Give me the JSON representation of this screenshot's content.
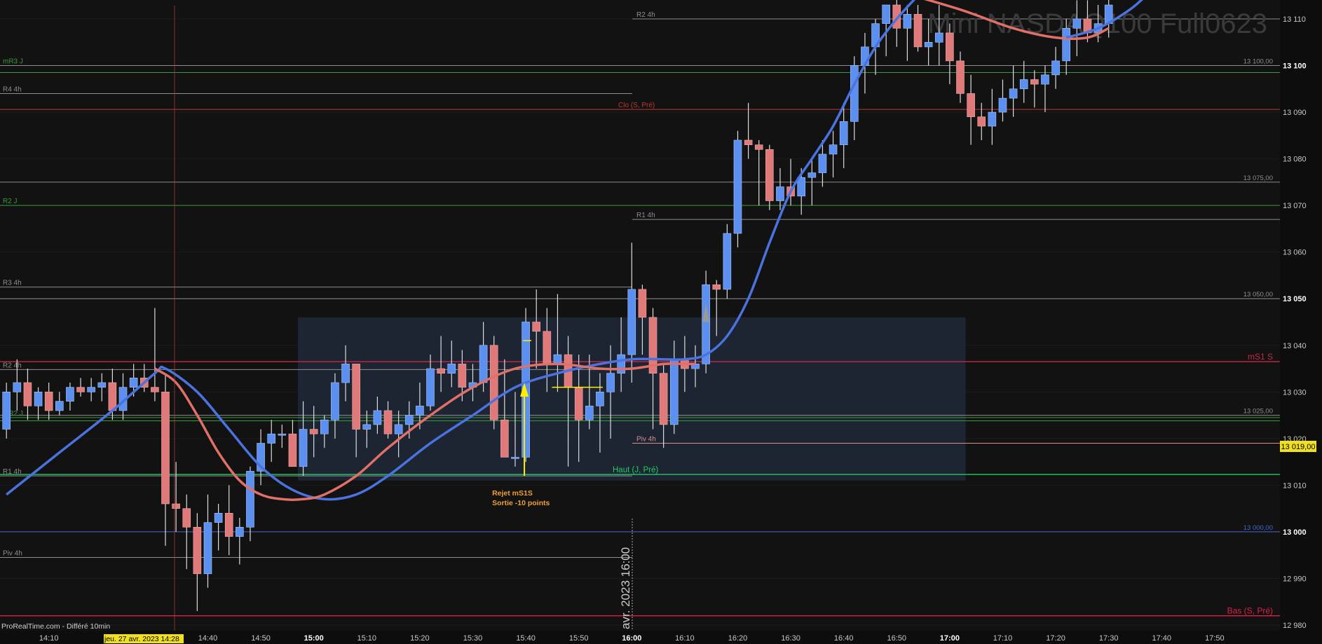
{
  "chart_data": {
    "type": "candlestick",
    "watermark": "Mini NASDAQ100 Full0623",
    "footer_note": "ProRealTime.com - Différé 10min",
    "cursor_label": "jeu. 27 avr. 2023 14:28",
    "vertical_date_label": "avr. 2023 16:00",
    "price_label": "13 019,00",
    "ylim": [
      12978,
      13113
    ],
    "y_ticks": [
      {
        "v": 13110,
        "t": "13 110",
        "b": false
      },
      {
        "v": 13100,
        "t": "13 100",
        "b": true
      },
      {
        "v": 13090,
        "t": "13 090",
        "b": false
      },
      {
        "v": 13080,
        "t": "13 080",
        "b": false
      },
      {
        "v": 13070,
        "t": "13 070",
        "b": false
      },
      {
        "v": 13060,
        "t": "13 060",
        "b": false
      },
      {
        "v": 13050,
        "t": "13 050",
        "b": true
      },
      {
        "v": 13040,
        "t": "13 040",
        "b": false
      },
      {
        "v": 13030,
        "t": "13 030",
        "b": false
      },
      {
        "v": 13020,
        "t": "13 020",
        "b": false
      },
      {
        "v": 13010,
        "t": "13 010",
        "b": false
      },
      {
        "v": 13000,
        "t": "13 000",
        "b": true
      },
      {
        "v": 12990,
        "t": "12 990",
        "b": false
      },
      {
        "v": 12980,
        "t": "12 980",
        "b": false
      }
    ],
    "x_ticks": [
      {
        "t": "14:10",
        "i": 4,
        "b": false
      },
      {
        "t": "14:40",
        "i": 19,
        "b": false
      },
      {
        "t": "14:50",
        "i": 24,
        "b": false
      },
      {
        "t": "15:00",
        "i": 29,
        "b": true
      },
      {
        "t": "15:10",
        "i": 34,
        "b": false
      },
      {
        "t": "15:20",
        "i": 39,
        "b": false
      },
      {
        "t": "15:30",
        "i": 44,
        "b": false
      },
      {
        "t": "15:40",
        "i": 49,
        "b": false
      },
      {
        "t": "15:50",
        "i": 54,
        "b": false
      },
      {
        "t": "16:00",
        "i": 59,
        "b": true
      },
      {
        "t": "16:10",
        "i": 64,
        "b": false
      },
      {
        "t": "16:20",
        "i": 69,
        "b": false
      },
      {
        "t": "16:30",
        "i": 74,
        "b": false
      },
      {
        "t": "16:40",
        "i": 79,
        "b": false
      },
      {
        "t": "16:50",
        "i": 84,
        "b": false
      },
      {
        "t": "17:00",
        "i": 89,
        "b": true
      },
      {
        "t": "17:10",
        "i": 94,
        "b": false
      },
      {
        "t": "17:20",
        "i": 99,
        "b": false
      },
      {
        "t": "17:30",
        "i": 104,
        "b": false
      },
      {
        "t": "17:40",
        "i": 109,
        "b": false
      },
      {
        "t": "17:50",
        "i": 114,
        "b": false
      }
    ],
    "levels": [
      {
        "label": "R2 4h",
        "price": 13110,
        "color": "#8f8f8f",
        "label_pos": "mid",
        "start": "mid"
      },
      {
        "label": "mR3 J",
        "price": 13100,
        "color": "#3a9a3a",
        "label_pos": "left"
      },
      {
        "label": "",
        "price": 13098.5,
        "color": "#3a9a3a",
        "label_pos": "left"
      },
      {
        "label": "13 100,00",
        "price": 13100,
        "color": "#8f8f8f",
        "label_pos": "right"
      },
      {
        "label": "R4 4h",
        "price": 13094,
        "color": "#8f8f8f",
        "label_pos": "left",
        "end": "mid"
      },
      {
        "label": "Clo (S, Pré)",
        "price": 13090.6,
        "color": "#c0392b",
        "label_pos": "mid"
      },
      {
        "label": "13 075,00",
        "price": 13075,
        "color": "#8f8f8f",
        "label_pos": "right"
      },
      {
        "label": "R2 J",
        "price": 13070,
        "color": "#3a9a3a",
        "label_pos": "left"
      },
      {
        "label": "R1 4h",
        "price": 13067,
        "color": "#8f8f8f",
        "label_pos": "mid",
        "start": "mid"
      },
      {
        "label": "R3 4h",
        "price": 13052.5,
        "color": "#8f8f8f",
        "label_pos": "left",
        "end": "mid"
      },
      {
        "label": "13 050,00",
        "price": 13050,
        "color": "#8f8f8f",
        "label_pos": "right"
      },
      {
        "label": "mS1 S",
        "price": 13036.5,
        "color": "#c8284a",
        "label_pos": "right_big"
      },
      {
        "label": "R2 4h",
        "price": 13034.8,
        "color": "#8f8f8f",
        "label_pos": "left",
        "end": "mid"
      },
      {
        "label": "13 025,00",
        "price": 13025,
        "color": "#8f8f8f",
        "label_pos": "right"
      },
      {
        "label": "mR2 J",
        "price": 13024.5,
        "color": "#3a9a3a",
        "label_pos": "left"
      },
      {
        "label": "",
        "price": 13023.8,
        "color": "#3a9a3a",
        "label_pos": "left"
      },
      {
        "label": "Piv 4h",
        "price": 13019,
        "color": "#d89090",
        "label_pos": "mid",
        "start": "mid"
      },
      {
        "label": "Haut (J, Pré)",
        "price": 13012.3,
        "color": "#22cc66",
        "label_pos": "mid"
      },
      {
        "label": "R1 4h",
        "price": 13012,
        "color": "#8f8f8f",
        "label_pos": "left",
        "end": "mid"
      },
      {
        "label": "13 000,00",
        "price": 13000,
        "color": "#4466cc",
        "label_pos": "right"
      },
      {
        "label": "Piv 4h",
        "price": 12994.5,
        "color": "#8f8f8f",
        "label_pos": "left",
        "end": "mid"
      },
      {
        "label": "Bas (S, Pré)",
        "price": 12982,
        "color": "#e0204a",
        "label_pos": "right_big"
      }
    ],
    "highlight_zone": {
      "i0": 27.5,
      "i1": 90.5,
      "top": 13046,
      "bottom": 13011
    },
    "annotation": {
      "line1": "Rejet mS1S",
      "line2": "Sortie -10 points",
      "i": 49,
      "price": 13011
    },
    "x0_index_ref": 0,
    "candles": [
      [
        13022,
        13032,
        13020,
        13030
      ],
      [
        13030,
        13037,
        13026,
        13032
      ],
      [
        13032,
        13035,
        13024,
        13027
      ],
      [
        13027,
        13031,
        13024,
        13030
      ],
      [
        13030,
        13032,
        13024,
        13026
      ],
      [
        13026,
        13030,
        13025,
        13028
      ],
      [
        13028,
        13032,
        13026,
        13031
      ],
      [
        13031,
        13033,
        13029,
        13030
      ],
      [
        13030,
        13033,
        13028,
        13031
      ],
      [
        13031,
        13034,
        13028,
        13032
      ],
      [
        13032,
        13035,
        13024,
        13026
      ],
      [
        13026,
        13034,
        13024,
        13031
      ],
      [
        13031,
        13036,
        13029,
        13033
      ],
      [
        13033,
        13036,
        13030,
        13031
      ],
      [
        13031,
        13048,
        13028,
        13030
      ],
      [
        13030,
        13034,
        12997,
        13006
      ],
      [
        13006,
        13015,
        13000,
        13005
      ],
      [
        13005,
        13008,
        12992,
        13001
      ],
      [
        13001,
        13004,
        12983,
        12991
      ],
      [
        12991,
        13008,
        12988,
        13002
      ],
      [
        13002,
        13006,
        12996,
        13004
      ],
      [
        13004,
        13010,
        12995,
        12999
      ],
      [
        12999,
        13003,
        12993,
        13001
      ],
      [
        13001,
        13014,
        12998,
        13013
      ],
      [
        13013,
        13022,
        13010,
        13019
      ],
      [
        13019,
        13024,
        13015,
        13021
      ],
      [
        13021,
        13023,
        13018,
        13021
      ],
      [
        13021,
        13024,
        13016,
        13014
      ],
      [
        13014,
        13028,
        13012,
        13022
      ],
      [
        13022,
        13027,
        13016,
        13021
      ],
      [
        13021,
        13025,
        13018,
        13024
      ],
      [
        13024,
        13034,
        13020,
        13032
      ],
      [
        13032,
        13040,
        13028,
        13036
      ],
      [
        13036,
        13036,
        13016,
        13022
      ],
      [
        13022,
        13026,
        13018,
        13023
      ],
      [
        13023,
        13029,
        13021,
        13026
      ],
      [
        13026,
        13028,
        13020,
        13021
      ],
      [
        13021,
        13026,
        13016,
        13023
      ],
      [
        13023,
        13028,
        13020,
        13025
      ],
      [
        13025,
        13032,
        13022,
        13027
      ],
      [
        13027,
        13038,
        13026,
        13035
      ],
      [
        13035,
        13042,
        13030,
        13034
      ],
      [
        13034,
        13041,
        13031,
        13036
      ],
      [
        13036,
        13039,
        13028,
        13031
      ],
      [
        13031,
        13036,
        13028,
        13032
      ],
      [
        13032,
        13045,
        13030,
        13040
      ],
      [
        13040,
        13042,
        13022,
        13024
      ],
      [
        13024,
        13037,
        13019,
        13016
      ],
      [
        13016,
        13030,
        13014,
        13016
      ],
      [
        13016,
        13048,
        13015,
        13045
      ],
      [
        13045,
        13052,
        13035,
        13043
      ],
      [
        13043,
        13048,
        13030,
        13036
      ],
      [
        13036,
        13051,
        13030,
        13038
      ],
      [
        13038,
        13042,
        13014,
        13031
      ],
      [
        13031,
        13038,
        13015,
        13024
      ],
      [
        13024,
        13038,
        13022,
        13027
      ],
      [
        13027,
        13034,
        13017,
        13030
      ],
      [
        13030,
        13040,
        13020,
        13034
      ],
      [
        13034,
        13046,
        13030,
        13038
      ],
      [
        13038,
        13062,
        13032,
        13052
      ],
      [
        13052,
        13053,
        13038,
        13046
      ],
      [
        13046,
        13048,
        13022,
        13034
      ],
      [
        13034,
        13036,
        13018,
        13023
      ],
      [
        13023,
        13041,
        13021,
        13037
      ],
      [
        13037,
        13042,
        13030,
        13035
      ],
      [
        13035,
        13040,
        13031,
        13036
      ],
      [
        13036,
        13056,
        13034,
        13053
      ],
      [
        13053,
        13054,
        13042,
        13052
      ],
      [
        13052,
        13066,
        13050,
        13064
      ],
      [
        13064,
        13086,
        13061,
        13084
      ],
      [
        13084,
        13092,
        13080,
        13083
      ],
      [
        13083,
        13084,
        13070,
        13082
      ],
      [
        13082,
        13083,
        13069,
        13071
      ],
      [
        13071,
        13078,
        13069,
        13074
      ],
      [
        13074,
        13080,
        13070,
        13072
      ],
      [
        13072,
        13078,
        13068,
        13076
      ],
      [
        13076,
        13080,
        13070,
        13077
      ],
      [
        13077,
        13084,
        13074,
        13081
      ],
      [
        13081,
        13086,
        13076,
        13083
      ],
      [
        13083,
        13092,
        13078,
        13088
      ],
      [
        13088,
        13102,
        13084,
        13100
      ],
      [
        13100,
        13107,
        13094,
        13104
      ],
      [
        13104,
        13110,
        13098,
        13109
      ],
      [
        13109,
        13113,
        13102,
        13113
      ],
      [
        13113,
        13115,
        13104,
        13108
      ],
      [
        13108,
        13113,
        13101,
        13111
      ],
      [
        13111,
        13113,
        13103,
        13104
      ],
      [
        13104,
        13110,
        13100,
        13105
      ],
      [
        13105,
        13113,
        13100,
        13107
      ],
      [
        13107,
        13109,
        13096,
        13101
      ],
      [
        13101,
        13103,
        13092,
        13094
      ],
      [
        13094,
        13098,
        13083,
        13089
      ],
      [
        13089,
        13092,
        13084,
        13087
      ],
      [
        13087,
        13095,
        13083,
        13090
      ],
      [
        13090,
        13097,
        13088,
        13093
      ],
      [
        13093,
        13100,
        13089,
        13095
      ],
      [
        13095,
        13101,
        13092,
        13097
      ],
      [
        13097,
        13099,
        13091,
        13096
      ],
      [
        13096,
        13100,
        13090,
        13098
      ],
      [
        13098,
        13104,
        13095,
        13101
      ],
      [
        13101,
        13110,
        13098,
        13108
      ],
      [
        13108,
        13114,
        13102,
        13110
      ],
      [
        13110,
        13114,
        13105,
        13107
      ],
      [
        13107,
        13113,
        13105,
        13109
      ],
      [
        13109,
        13116,
        13106,
        13113
      ]
    ],
    "ma_blue": [
      [
        0,
        13008
      ],
      [
        5,
        13017
      ],
      [
        10,
        13026
      ],
      [
        14,
        13034
      ],
      [
        15,
        13035
      ],
      [
        18,
        13030
      ],
      [
        21,
        13022
      ],
      [
        24,
        13014
      ],
      [
        27,
        13009
      ],
      [
        30,
        13007
      ],
      [
        33,
        13008
      ],
      [
        36,
        13012
      ],
      [
        40,
        13019
      ],
      [
        44,
        13025
      ],
      [
        48,
        13031
      ],
      [
        52,
        13034
      ],
      [
        56,
        13036
      ],
      [
        59,
        13037
      ],
      [
        62,
        13037
      ],
      [
        64,
        13037
      ],
      [
        66,
        13038
      ],
      [
        68,
        13042
      ],
      [
        70,
        13050
      ],
      [
        72,
        13062
      ],
      [
        74,
        13073
      ],
      [
        76,
        13080
      ],
      [
        78,
        13087
      ],
      [
        80,
        13096
      ],
      [
        82,
        13104
      ],
      [
        84,
        13110
      ],
      [
        86,
        13115
      ]
    ],
    "ma_red": [
      [
        14,
        13035
      ],
      [
        16,
        13032
      ],
      [
        18,
        13025
      ],
      [
        20,
        13017
      ],
      [
        22,
        13011
      ],
      [
        24,
        13008
      ],
      [
        26,
        13007
      ],
      [
        28,
        13007
      ],
      [
        30,
        13008
      ],
      [
        33,
        13012
      ],
      [
        36,
        13018
      ],
      [
        40,
        13025
      ],
      [
        44,
        13031
      ],
      [
        48,
        13035
      ],
      [
        52,
        13036
      ],
      [
        56,
        13035
      ],
      [
        59,
        13035
      ],
      [
        62,
        13036
      ],
      [
        64,
        13036
      ],
      [
        65,
        13036
      ]
    ],
    "ma_red2": [
      [
        84,
        13116
      ],
      [
        90,
        13112
      ],
      [
        95,
        13108
      ],
      [
        99,
        13106
      ],
      [
        102,
        13106
      ],
      [
        104,
        13108
      ]
    ],
    "ma_blue2": [
      [
        100,
        13106
      ],
      [
        103,
        13108
      ],
      [
        106,
        13112
      ],
      [
        108,
        13116
      ]
    ]
  }
}
